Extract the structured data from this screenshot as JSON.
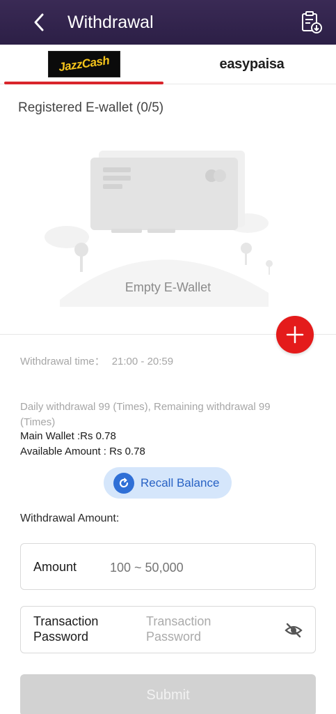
{
  "header": {
    "title": "Withdrawal",
    "back_icon": "chevron-left-icon",
    "records_icon": "clipboard-download-icon"
  },
  "tabs": [
    {
      "label": "JazzCash",
      "active": true
    },
    {
      "label": "easypaisa",
      "active": false
    }
  ],
  "wallet_section": {
    "title": "Registered E-wallet (0/5)",
    "empty_text": "Empty E-Wallet",
    "add_icon": "plus-icon"
  },
  "info": {
    "withdrawal_time_label": "Withdrawal time：",
    "withdrawal_time_value": "21:00 - 20:59",
    "daily_limit": "Daily withdrawal 99 (Times), Remaining withdrawal 99 (Times)",
    "main_wallet": "Main Wallet :Rs 0.78",
    "available_amount": "Available Amount : Rs 0.78"
  },
  "recall": {
    "label": "Recall Balance",
    "icon": "refresh-icon"
  },
  "form": {
    "withdrawal_amount_label": "Withdrawal Amount:",
    "amount_label": "Amount",
    "amount_placeholder": "100 ~ 50,000",
    "password_label": "Transaction Password",
    "password_placeholder": "Transaction Password",
    "eye_icon": "eye-off-icon",
    "submit_label": "Submit"
  },
  "colors": {
    "header_bg": "#2c1f46",
    "accent_red": "#e41b1b",
    "recall_bg": "#d5e6fb",
    "recall_text": "#2862c4",
    "submit_disabled": "#d2d2d2"
  }
}
